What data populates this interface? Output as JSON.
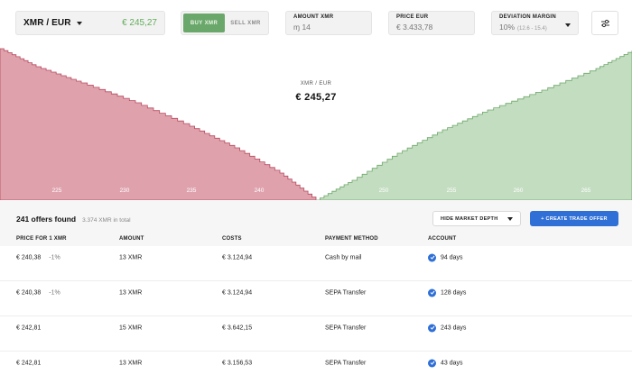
{
  "toolbar": {
    "pair": "XMR / EUR",
    "pair_price": "€ 245,27",
    "buy_label": "BUY XMR",
    "sell_label": "SELL XMR",
    "amount_label": "AMOUNT XMR",
    "amount_value": "ɱ 14",
    "price_label": "PRICE EUR",
    "price_value": "€ 3.433,78",
    "deviation_label": "DEVIATION MARGIN",
    "deviation_value": "10%",
    "deviation_range": "(12.6 - 15.4)"
  },
  "chart": {
    "mid_pair": "XMR / EUR",
    "mid_price": "€ 245,27",
    "x_ticks": [
      "225",
      "230",
      "235",
      "240",
      "250",
      "255",
      "260",
      "265"
    ],
    "bid_color": "#dfa2ad",
    "bid_stroke": "#b84a5e",
    "ask_color": "#c3ddc0",
    "ask_stroke": "#6fa86a"
  },
  "offers": {
    "count": "241 offers found",
    "total": "3.374 XMR in total",
    "hide_depth_label": "HIDE MARKET DEPTH",
    "create_label": "+ CREATE TRADE OFFER",
    "columns": [
      "PRICE FOR 1 XMR",
      "AMOUNT",
      "COSTS",
      "PAYMENT METHOD",
      "ACCOUNT"
    ],
    "rows": [
      {
        "price": "€ 240,38",
        "pct": "-1%",
        "amount": "13 XMR",
        "costs": "€ 3.124,94",
        "method": "Cash by mail",
        "account": "94 days"
      },
      {
        "price": "€ 240,38",
        "pct": "-1%",
        "amount": "13 XMR",
        "costs": "€ 3.124,94",
        "method": "SEPA Transfer",
        "account": "128 days"
      },
      {
        "price": "€ 242,81",
        "pct": "",
        "amount": "15 XMR",
        "costs": "€ 3.642,15",
        "method": "SEPA Transfer",
        "account": "243 days"
      },
      {
        "price": "€ 242,81",
        "pct": "",
        "amount": "13 XMR",
        "costs": "€ 3.156,53",
        "method": "SEPA Transfer",
        "account": "43 days"
      }
    ]
  }
}
